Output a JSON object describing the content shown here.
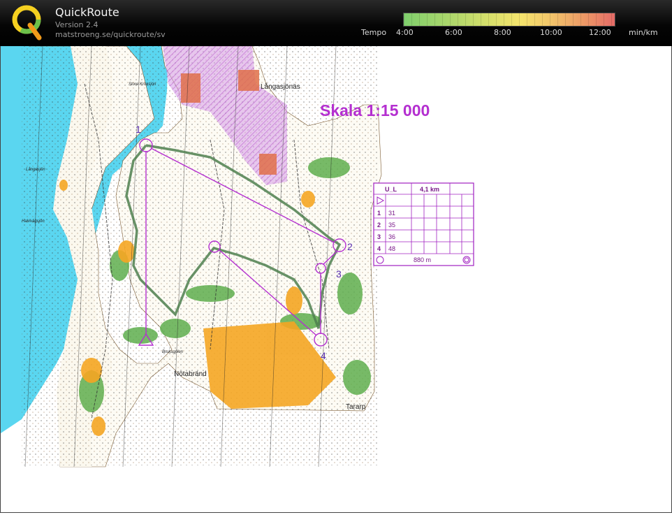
{
  "app": {
    "title": "QuickRoute",
    "version": "Version 2.4",
    "url": "matstroeng.se/quickroute/sv"
  },
  "tempo": {
    "label": "Tempo",
    "ticks": [
      "4:00",
      "6:00",
      "8:00",
      "10:00",
      "12:00"
    ],
    "unit": "min/km",
    "gradient_colors": [
      "#7fcf6d",
      "#f4e46d",
      "#e56b67"
    ]
  },
  "map": {
    "scale_text": "Skala 1:15 000",
    "place_names": [
      "Långasjönäs",
      "Nötabränd",
      "Tararp",
      "Store Kroksjön",
      "Långasjön",
      "Halvvägsjön",
      "Bruksgölen"
    ],
    "control_numbers": [
      "1",
      "2",
      "3",
      "4"
    ],
    "colors": {
      "water": "#5ad6f0",
      "forest": "#ffffff",
      "green": "#58a84a",
      "open": "#f5a623",
      "purple": "#b42fd0",
      "route": "#4e7f4e"
    }
  },
  "control_card": {
    "class": "U_L",
    "length": "4,1 km",
    "rows": [
      {
        "num": "1",
        "code": "31"
      },
      {
        "num": "2",
        "code": "35"
      },
      {
        "num": "3",
        "code": "36"
      },
      {
        "num": "4",
        "code": "48"
      }
    ],
    "finish_distance": "880 m"
  }
}
